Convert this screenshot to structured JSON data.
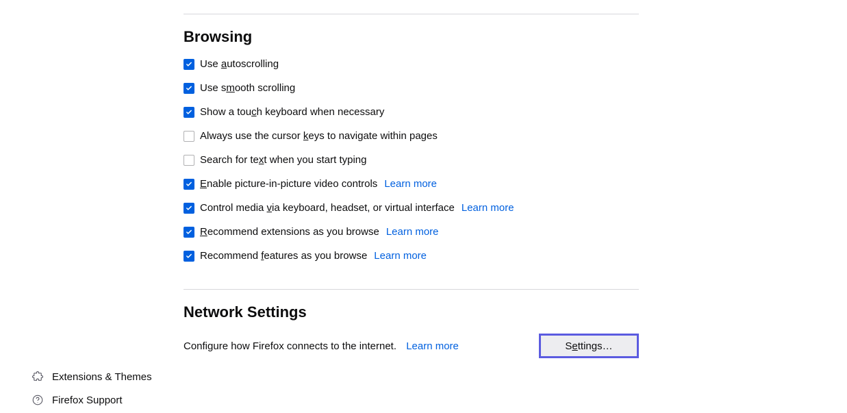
{
  "browsing": {
    "title": "Browsing",
    "items": [
      {
        "before": "Use ",
        "u": "a",
        "after": "utoscrolling",
        "checked": true
      },
      {
        "before": "Use s",
        "u": "m",
        "after": "ooth scrolling",
        "checked": true
      },
      {
        "before": "Show a tou",
        "u": "c",
        "after": "h keyboard when necessary",
        "checked": true
      },
      {
        "before": "Always use the cursor ",
        "u": "k",
        "after": "eys to navigate within pages",
        "checked": false
      },
      {
        "before": "Search for te",
        "u": "x",
        "after": "t when you start typing",
        "checked": false
      },
      {
        "before": "",
        "u": "E",
        "after": "nable picture-in-picture video controls",
        "checked": true,
        "learn": "Learn more"
      },
      {
        "before": "Control media ",
        "u": "v",
        "after": "ia keyboard, headset, or virtual interface",
        "checked": true,
        "learn": "Learn more"
      },
      {
        "before": "",
        "u": "R",
        "after": "ecommend extensions as you browse",
        "checked": true,
        "learn": "Learn more"
      },
      {
        "before": "Recommend ",
        "u": "f",
        "after": "eatures as you browse",
        "checked": true,
        "learn": "Learn more"
      }
    ]
  },
  "network": {
    "title": "Network Settings",
    "desc": "Configure how Firefox connects to the internet.",
    "learn": "Learn more",
    "button_before": "S",
    "button_u": "e",
    "button_after": "ttings…"
  },
  "sidebar": {
    "extensions": "Extensions & Themes",
    "support": "Firefox Support"
  }
}
